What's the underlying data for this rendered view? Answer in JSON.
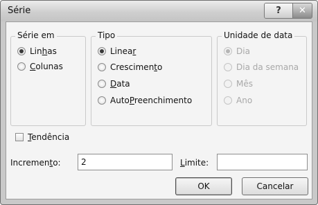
{
  "window": {
    "title": "Série"
  },
  "titlebar": {
    "help_glyph": "?",
    "close_glyph": "✕"
  },
  "serie_em": {
    "legend": "Série em",
    "options": [
      {
        "pre": "Lin",
        "acc": "h",
        "post": "as",
        "selected": true
      },
      {
        "pre": "",
        "acc": "C",
        "post": "olunas",
        "selected": false
      }
    ]
  },
  "tipo": {
    "legend": "Tipo",
    "options": [
      {
        "pre": "Linea",
        "acc": "r",
        "post": "",
        "selected": true
      },
      {
        "pre": "Crescimen",
        "acc": "t",
        "post": "o",
        "selected": false
      },
      {
        "pre": "",
        "acc": "D",
        "post": "ata",
        "selected": false
      },
      {
        "pre": "Auto",
        "acc": "P",
        "post": "reenchimento",
        "selected": false
      }
    ]
  },
  "unidade": {
    "legend": "Unidade de data",
    "options": [
      {
        "label": "Dia",
        "selected": true
      },
      {
        "label": "Dia da semana",
        "selected": false
      },
      {
        "label": "Mês",
        "selected": false
      },
      {
        "label": "Ano",
        "selected": false
      }
    ]
  },
  "tendencia": {
    "acc": "T",
    "post": "endência",
    "checked": false
  },
  "incremento": {
    "pre": "Incremen",
    "acc": "t",
    "post": "o:",
    "value": "2"
  },
  "limite": {
    "acc": "L",
    "post": "imite:",
    "value": ""
  },
  "buttons": {
    "ok": "OK",
    "cancel": "Cancelar"
  }
}
